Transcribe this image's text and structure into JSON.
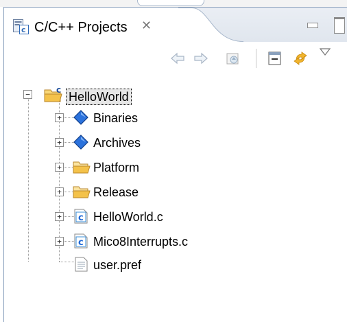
{
  "view": {
    "title": "C/C++ Projects",
    "icons": {
      "view_icon": "cpp-projects-view-icon",
      "close": "close-icon",
      "minimize": "minimize-icon",
      "maximize": "maximize-icon"
    }
  },
  "toolbar": {
    "buttons": [
      {
        "name": "back-button",
        "icon": "back-arrow-icon"
      },
      {
        "name": "forward-button",
        "icon": "forward-arrow-icon"
      },
      {
        "name": "up-button",
        "icon": "up-folder-icon"
      },
      {
        "name": "collapse-all-button",
        "icon": "collapse-all-icon"
      },
      {
        "name": "link-with-editor-button",
        "icon": "link-editor-icon"
      },
      {
        "name": "view-menu-button",
        "icon": "dropdown-triangle-icon"
      }
    ]
  },
  "tree": {
    "root": {
      "label": "HelloWorld",
      "expanded": true,
      "selected": true,
      "icon": "c-project-folder-icon"
    },
    "children": [
      {
        "label": "Binaries",
        "icon": "binaries-diamond-icon",
        "expandable": true
      },
      {
        "label": "Archives",
        "icon": "archives-diamond-icon",
        "expandable": true
      },
      {
        "label": "Platform",
        "icon": "folder-icon",
        "expandable": true
      },
      {
        "label": "Release",
        "icon": "folder-icon",
        "expandable": true
      },
      {
        "label": "HelloWorld.c",
        "icon": "c-source-file-icon",
        "expandable": true
      },
      {
        "label": "Mico8Interrupts.c",
        "icon": "c-source-file-icon",
        "expandable": true
      },
      {
        "label": "user.pref",
        "icon": "text-file-icon",
        "expandable": false
      }
    ]
  },
  "colors": {
    "frame_border": "#8aa1bd",
    "diamond": "#1f68d6",
    "folder": "#f4c24a",
    "c_file": "#3a8fd9"
  }
}
